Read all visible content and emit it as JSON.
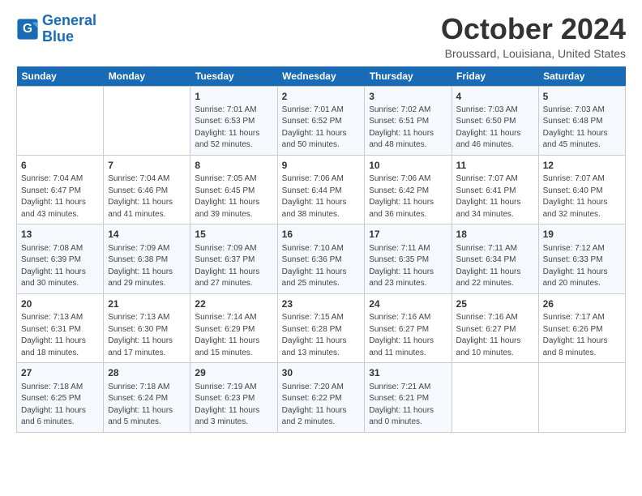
{
  "logo": {
    "line1": "General",
    "line2": "Blue"
  },
  "title": "October 2024",
  "location": "Broussard, Louisiana, United States",
  "days_header": [
    "Sunday",
    "Monday",
    "Tuesday",
    "Wednesday",
    "Thursday",
    "Friday",
    "Saturday"
  ],
  "weeks": [
    [
      {
        "num": "",
        "detail": ""
      },
      {
        "num": "",
        "detail": ""
      },
      {
        "num": "1",
        "detail": "Sunrise: 7:01 AM\nSunset: 6:53 PM\nDaylight: 11 hours and 52 minutes."
      },
      {
        "num": "2",
        "detail": "Sunrise: 7:01 AM\nSunset: 6:52 PM\nDaylight: 11 hours and 50 minutes."
      },
      {
        "num": "3",
        "detail": "Sunrise: 7:02 AM\nSunset: 6:51 PM\nDaylight: 11 hours and 48 minutes."
      },
      {
        "num": "4",
        "detail": "Sunrise: 7:03 AM\nSunset: 6:50 PM\nDaylight: 11 hours and 46 minutes."
      },
      {
        "num": "5",
        "detail": "Sunrise: 7:03 AM\nSunset: 6:48 PM\nDaylight: 11 hours and 45 minutes."
      }
    ],
    [
      {
        "num": "6",
        "detail": "Sunrise: 7:04 AM\nSunset: 6:47 PM\nDaylight: 11 hours and 43 minutes."
      },
      {
        "num": "7",
        "detail": "Sunrise: 7:04 AM\nSunset: 6:46 PM\nDaylight: 11 hours and 41 minutes."
      },
      {
        "num": "8",
        "detail": "Sunrise: 7:05 AM\nSunset: 6:45 PM\nDaylight: 11 hours and 39 minutes."
      },
      {
        "num": "9",
        "detail": "Sunrise: 7:06 AM\nSunset: 6:44 PM\nDaylight: 11 hours and 38 minutes."
      },
      {
        "num": "10",
        "detail": "Sunrise: 7:06 AM\nSunset: 6:42 PM\nDaylight: 11 hours and 36 minutes."
      },
      {
        "num": "11",
        "detail": "Sunrise: 7:07 AM\nSunset: 6:41 PM\nDaylight: 11 hours and 34 minutes."
      },
      {
        "num": "12",
        "detail": "Sunrise: 7:07 AM\nSunset: 6:40 PM\nDaylight: 11 hours and 32 minutes."
      }
    ],
    [
      {
        "num": "13",
        "detail": "Sunrise: 7:08 AM\nSunset: 6:39 PM\nDaylight: 11 hours and 30 minutes."
      },
      {
        "num": "14",
        "detail": "Sunrise: 7:09 AM\nSunset: 6:38 PM\nDaylight: 11 hours and 29 minutes."
      },
      {
        "num": "15",
        "detail": "Sunrise: 7:09 AM\nSunset: 6:37 PM\nDaylight: 11 hours and 27 minutes."
      },
      {
        "num": "16",
        "detail": "Sunrise: 7:10 AM\nSunset: 6:36 PM\nDaylight: 11 hours and 25 minutes."
      },
      {
        "num": "17",
        "detail": "Sunrise: 7:11 AM\nSunset: 6:35 PM\nDaylight: 11 hours and 23 minutes."
      },
      {
        "num": "18",
        "detail": "Sunrise: 7:11 AM\nSunset: 6:34 PM\nDaylight: 11 hours and 22 minutes."
      },
      {
        "num": "19",
        "detail": "Sunrise: 7:12 AM\nSunset: 6:33 PM\nDaylight: 11 hours and 20 minutes."
      }
    ],
    [
      {
        "num": "20",
        "detail": "Sunrise: 7:13 AM\nSunset: 6:31 PM\nDaylight: 11 hours and 18 minutes."
      },
      {
        "num": "21",
        "detail": "Sunrise: 7:13 AM\nSunset: 6:30 PM\nDaylight: 11 hours and 17 minutes."
      },
      {
        "num": "22",
        "detail": "Sunrise: 7:14 AM\nSunset: 6:29 PM\nDaylight: 11 hours and 15 minutes."
      },
      {
        "num": "23",
        "detail": "Sunrise: 7:15 AM\nSunset: 6:28 PM\nDaylight: 11 hours and 13 minutes."
      },
      {
        "num": "24",
        "detail": "Sunrise: 7:16 AM\nSunset: 6:27 PM\nDaylight: 11 hours and 11 minutes."
      },
      {
        "num": "25",
        "detail": "Sunrise: 7:16 AM\nSunset: 6:27 PM\nDaylight: 11 hours and 10 minutes."
      },
      {
        "num": "26",
        "detail": "Sunrise: 7:17 AM\nSunset: 6:26 PM\nDaylight: 11 hours and 8 minutes."
      }
    ],
    [
      {
        "num": "27",
        "detail": "Sunrise: 7:18 AM\nSunset: 6:25 PM\nDaylight: 11 hours and 6 minutes."
      },
      {
        "num": "28",
        "detail": "Sunrise: 7:18 AM\nSunset: 6:24 PM\nDaylight: 11 hours and 5 minutes."
      },
      {
        "num": "29",
        "detail": "Sunrise: 7:19 AM\nSunset: 6:23 PM\nDaylight: 11 hours and 3 minutes."
      },
      {
        "num": "30",
        "detail": "Sunrise: 7:20 AM\nSunset: 6:22 PM\nDaylight: 11 hours and 2 minutes."
      },
      {
        "num": "31",
        "detail": "Sunrise: 7:21 AM\nSunset: 6:21 PM\nDaylight: 11 hours and 0 minutes."
      },
      {
        "num": "",
        "detail": ""
      },
      {
        "num": "",
        "detail": ""
      }
    ]
  ]
}
